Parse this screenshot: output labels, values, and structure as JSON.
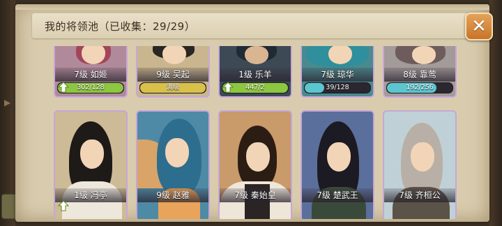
{
  "title": "我的将领池（已收集：29/29）",
  "close_icon": "close-x",
  "top_row": [
    {
      "label": "7级  如姬",
      "bar": "302/128",
      "fill": 1.0,
      "fill_color": "#8dc63f",
      "upgrade": true
    },
    {
      "label": "9级  吴起",
      "bar": "满级",
      "fill": 1.0,
      "fill_color": "#d9c04a",
      "upgrade": false
    },
    {
      "label": "1级  乐羊",
      "bar": "447/2",
      "fill": 1.0,
      "fill_color": "#8dc63f",
      "upgrade": true
    },
    {
      "label": "7级  琼华",
      "bar": "39/128",
      "fill": 0.3,
      "fill_color": "#5bc6cf",
      "upgrade": false
    },
    {
      "label": "8级  靠莺",
      "bar": "192/256",
      "fill": 0.75,
      "fill_color": "#5bc6cf",
      "upgrade": false
    }
  ],
  "bottom_row": [
    {
      "label": "1级  冯亭",
      "upgrade": true
    },
    {
      "label": "9级  赵雅",
      "upgrade": false
    },
    {
      "label": "7级 秦始皇",
      "upgrade": false
    },
    {
      "label": "7级 楚武王",
      "upgrade": false
    },
    {
      "label": "7级 齐桓公",
      "upgrade": false
    }
  ]
}
